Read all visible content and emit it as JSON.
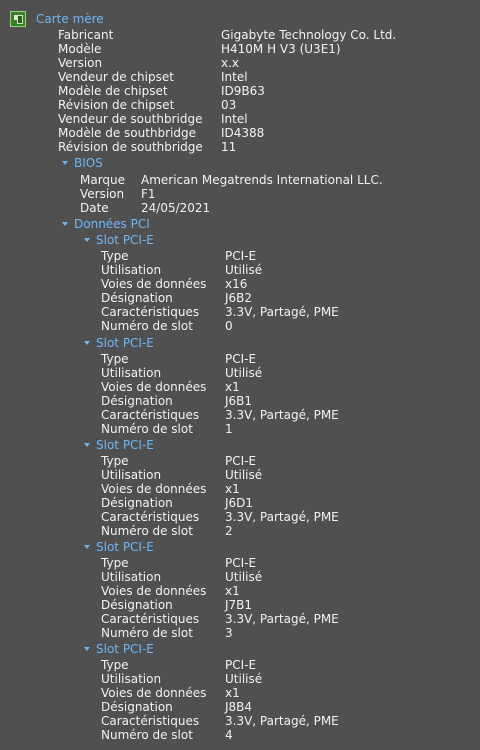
{
  "carte_mere": {
    "title": "Carte mère",
    "props": [
      {
        "label": "Fabricant",
        "value": "Gigabyte Technology Co. Ltd."
      },
      {
        "label": "Modèle",
        "value": "H410M H V3 (U3E1)"
      },
      {
        "label": "Version",
        "value": "x.x"
      },
      {
        "label": "Vendeur de chipset",
        "value": "Intel"
      },
      {
        "label": "Modèle de chipset",
        "value": "ID9B63"
      },
      {
        "label": "Révision de chipset",
        "value": "03"
      },
      {
        "label": "Vendeur de southbridge",
        "value": "Intel"
      },
      {
        "label": "Modèle de southbridge",
        "value": "ID4388"
      },
      {
        "label": "Révision de southbridge",
        "value": "11"
      }
    ]
  },
  "bios": {
    "title": "BIOS",
    "props": [
      {
        "label": "Marque",
        "value": "American Megatrends International LLC."
      },
      {
        "label": "Version",
        "value": "F1"
      },
      {
        "label": "Date",
        "value": "24/05/2021"
      }
    ]
  },
  "pci": {
    "title": "Données PCI",
    "slots": [
      {
        "title": "Slot PCI-E",
        "props": [
          {
            "label": "Type",
            "value": "PCI-E"
          },
          {
            "label": "Utilisation",
            "value": "Utilisé"
          },
          {
            "label": "Voies de données",
            "value": "x16"
          },
          {
            "label": "Désignation",
            "value": "J6B2"
          },
          {
            "label": "Caractéristiques",
            "value": "3.3V, Partagé, PME"
          },
          {
            "label": "Numéro de slot",
            "value": "0"
          }
        ]
      },
      {
        "title": "Slot PCI-E",
        "props": [
          {
            "label": "Type",
            "value": "PCI-E"
          },
          {
            "label": "Utilisation",
            "value": "Utilisé"
          },
          {
            "label": "Voies de données",
            "value": "x1"
          },
          {
            "label": "Désignation",
            "value": "J6B1"
          },
          {
            "label": "Caractéristiques",
            "value": "3.3V, Partagé, PME"
          },
          {
            "label": "Numéro de slot",
            "value": "1"
          }
        ]
      },
      {
        "title": "Slot PCI-E",
        "props": [
          {
            "label": "Type",
            "value": "PCI-E"
          },
          {
            "label": "Utilisation",
            "value": "Utilisé"
          },
          {
            "label": "Voies de données",
            "value": "x1"
          },
          {
            "label": "Désignation",
            "value": "J6D1"
          },
          {
            "label": "Caractéristiques",
            "value": "3.3V, Partagé, PME"
          },
          {
            "label": "Numéro de slot",
            "value": "2"
          }
        ]
      },
      {
        "title": "Slot PCI-E",
        "props": [
          {
            "label": "Type",
            "value": "PCI-E"
          },
          {
            "label": "Utilisation",
            "value": "Utilisé"
          },
          {
            "label": "Voies de données",
            "value": "x1"
          },
          {
            "label": "Désignation",
            "value": "J7B1"
          },
          {
            "label": "Caractéristiques",
            "value": "3.3V, Partagé, PME"
          },
          {
            "label": "Numéro de slot",
            "value": "3"
          }
        ]
      },
      {
        "title": "Slot PCI-E",
        "props": [
          {
            "label": "Type",
            "value": "PCI-E"
          },
          {
            "label": "Utilisation",
            "value": "Utilisé"
          },
          {
            "label": "Voies de données",
            "value": "x1"
          },
          {
            "label": "Désignation",
            "value": "J8B4"
          },
          {
            "label": "Caractéristiques",
            "value": "3.3V, Partagé, PME"
          },
          {
            "label": "Numéro de slot",
            "value": "4"
          }
        ]
      }
    ]
  },
  "colors": {
    "background": "#505050",
    "text": "#f2f2f2",
    "section": "#6fb6f5"
  },
  "icons": {
    "header": "motherboard-icon",
    "expand": "triangle-down-icon"
  }
}
